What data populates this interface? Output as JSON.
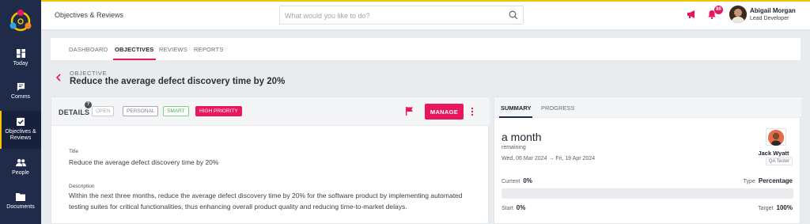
{
  "sidebar": {
    "items": [
      {
        "label": "Today",
        "icon": "dashboard-icon"
      },
      {
        "label": "Comms",
        "icon": "chat-icon"
      },
      {
        "label": "Objectives & Reviews",
        "icon": "checkbox-icon"
      },
      {
        "label": "People",
        "icon": "people-icon"
      },
      {
        "label": "Documents",
        "icon": "folder-icon"
      }
    ]
  },
  "header": {
    "title": "Objectives & Reviews",
    "search_placeholder": "What would you like to do?",
    "notifications_count": "86",
    "user": {
      "name": "Abigail Morgan",
      "role": "Lead Developer"
    }
  },
  "tabs": [
    "DASHBOARD",
    "OBJECTIVES",
    "REVIEWS",
    "REPORTS"
  ],
  "objective": {
    "label": "OBJECTIVE",
    "title": "Reduce the average defect discovery time by 20%"
  },
  "details": {
    "heading": "DETAILS",
    "help": "?",
    "tags": {
      "open": "OPEN",
      "personal": "PERSONAL",
      "smart": "SMART",
      "priority": "HIGH PRIORITY"
    },
    "manage_label": "MANAGE",
    "title_label": "Title",
    "title_value": "Reduce the average defect discovery time by 20%",
    "description_label": "Description",
    "description_value": "Within the next three months, reduce the average defect discovery time by 20% for the software product by implementing automated testing suites for critical functionalities, thus enhancing overall product quality and reducing time-to-market delays."
  },
  "summary": {
    "tabs": [
      "SUMMARY",
      "PROGRESS"
    ],
    "duration": "a month",
    "remaining": "remaining",
    "date_range": "Wed, 06 Mar 2024 → Fri, 19 Apr 2024",
    "owner": {
      "name": "Jack Wyatt",
      "role": "QA Tester"
    },
    "current_label": "Current",
    "current_value": "0%",
    "type_label": "Type",
    "type_value": "Percentage",
    "start_label": "Start",
    "start_value": "0%",
    "target_label": "Target",
    "target_value": "100%",
    "progress_fraction": 0
  },
  "colors": {
    "accent": "#e8175d",
    "sidebar": "#1f2b49",
    "highlight": "#f5c400",
    "smart": "#3cb44b"
  }
}
